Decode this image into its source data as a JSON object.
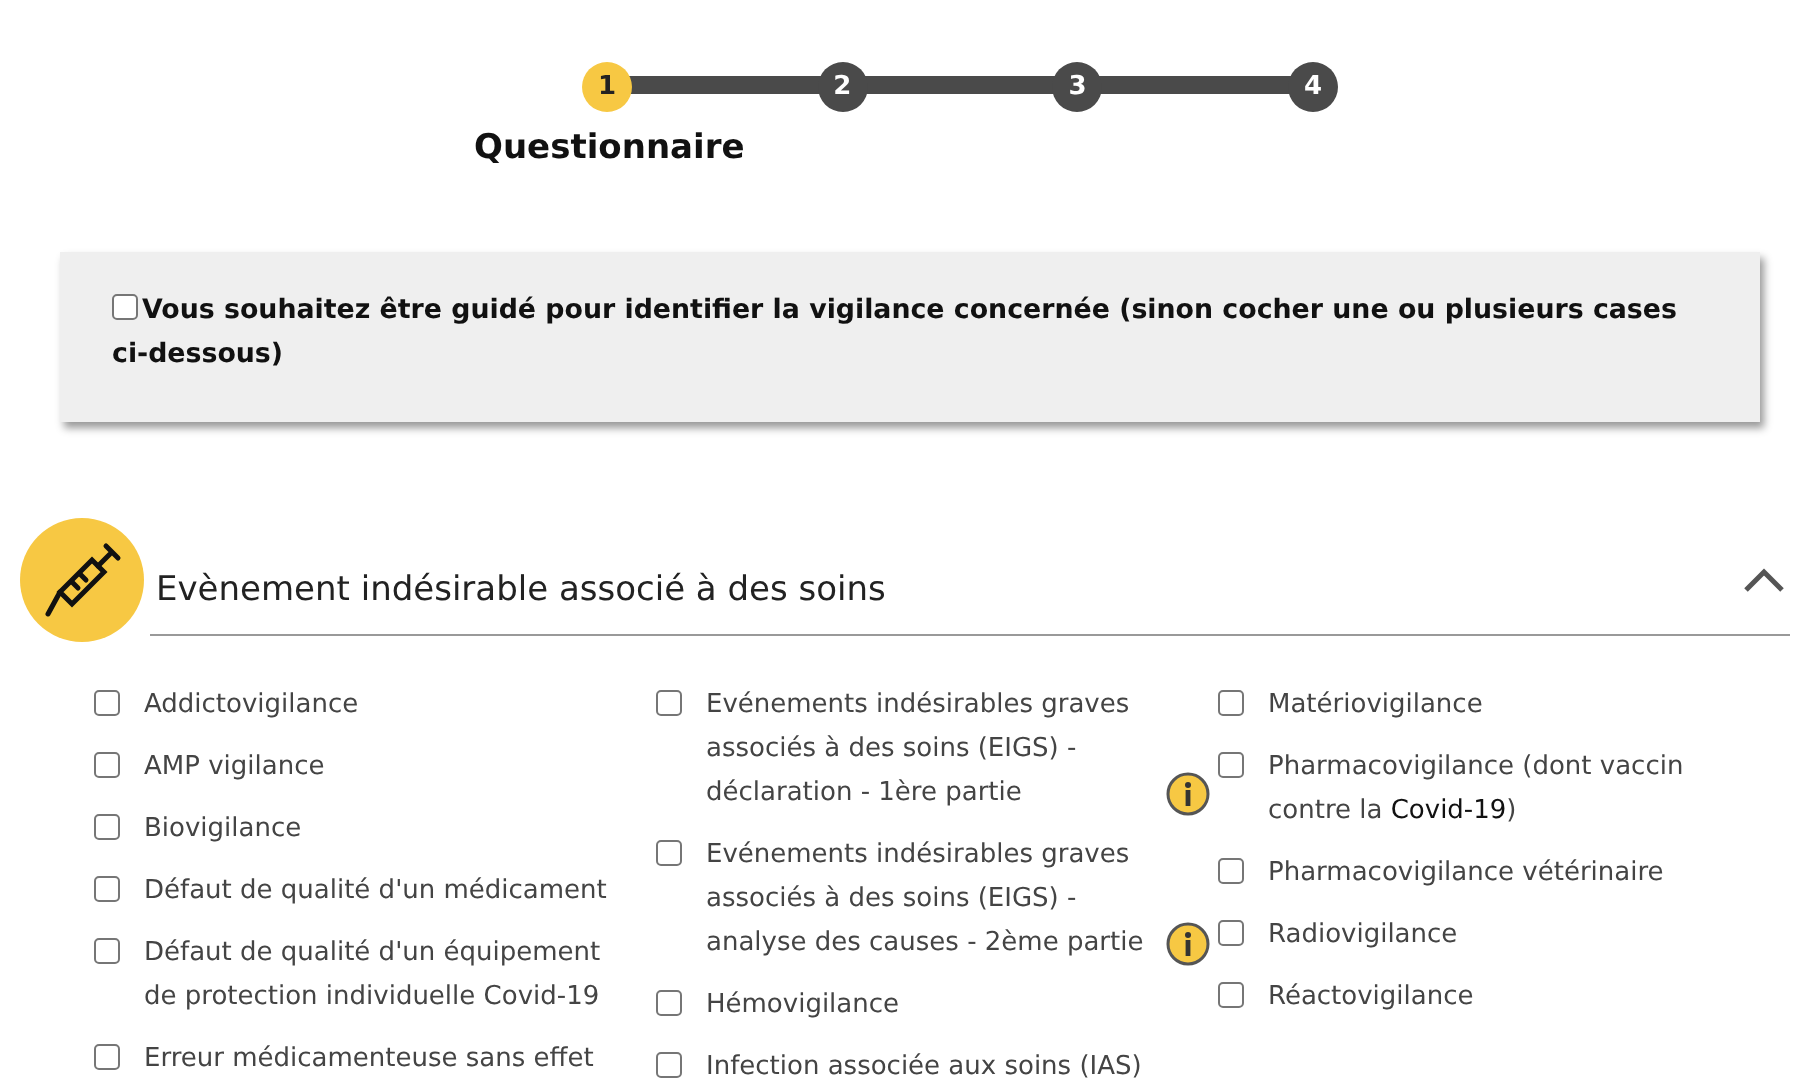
{
  "stepper": {
    "steps": [
      {
        "number": "1",
        "selected": true
      },
      {
        "number": "2",
        "selected": false
      },
      {
        "number": "3",
        "selected": false
      },
      {
        "number": "4",
        "selected": false
      }
    ],
    "current_label": "Questionnaire"
  },
  "guide": {
    "label": "Vous souhaitez être guidé pour identifier la vigilance concernée (sinon cocher une ou plusieurs cases ci-dessous)",
    "checked": false
  },
  "section": {
    "title": "Evènement indésirable associé à des soins",
    "expanded": true,
    "columns": [
      [
        {
          "label": "Addictovigilance",
          "checked": false,
          "info": false
        },
        {
          "label": "AMP vigilance",
          "checked": false,
          "info": false
        },
        {
          "label": "Biovigilance",
          "checked": false,
          "info": false
        },
        {
          "label": "Défaut de qualité d'un médicament",
          "checked": false,
          "info": false
        },
        {
          "label": "Défaut de qualité d'un équipement de protection individuelle Covid-19",
          "checked": false,
          "info": false
        },
        {
          "label": "Erreur médicamenteuse sans effet",
          "checked": false,
          "info": false
        }
      ],
      [
        {
          "label": "Evénements indésirables graves associés à des soins (EIGS) - déclaration - 1ère partie",
          "checked": false,
          "info": true
        },
        {
          "label": "Evénements indésirables graves associés à des soins (EIGS) - analyse des causes - 2ème partie",
          "checked": false,
          "info": true
        },
        {
          "label": "Hémovigilance",
          "checked": false,
          "info": false
        },
        {
          "label": "Infection associée aux soins (IAS)",
          "checked": false,
          "info": false
        }
      ],
      [
        {
          "label": "Matériovigilance",
          "checked": false,
          "info": false
        },
        {
          "label": "Pharmacovigilance (dont vaccin contre la **Covid-19**)",
          "checked": false,
          "info": false
        },
        {
          "label": "Pharmacovigilance vétérinaire",
          "checked": false,
          "info": false
        },
        {
          "label": "Radiovigilance",
          "checked": false,
          "info": false
        },
        {
          "label": "Réactovigilance",
          "checked": false,
          "info": false
        }
      ]
    ]
  }
}
